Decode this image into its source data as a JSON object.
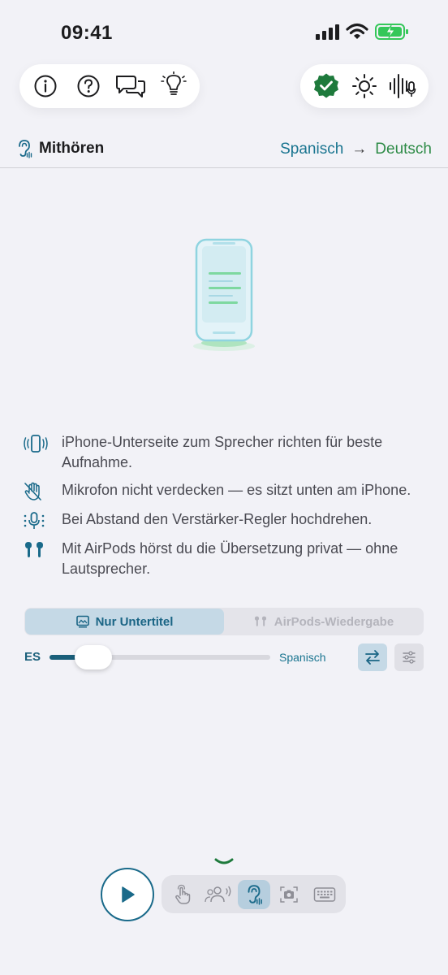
{
  "status_bar": {
    "time": "09:41"
  },
  "toolbar": {
    "left_icons": [
      "info-icon",
      "help-icon",
      "chat-bubbles-icon",
      "lightbulb-icon"
    ],
    "right_icons": [
      "verified-check-icon",
      "brightness-icon",
      "voice-waveform-icon"
    ]
  },
  "mode": {
    "label": "Mithören",
    "source_language": "Spanisch",
    "arrow": "→",
    "target_language": "Deutsch"
  },
  "tips": [
    {
      "icon": "phone-vibrate-icon",
      "text": "iPhone-Unterseite zum Sprecher richten für beste Aufnahme."
    },
    {
      "icon": "hand-slash-icon",
      "text": "Mikrofon nicht verdecken — es sitzt unten am iPhone."
    },
    {
      "icon": "mic-volume-icon",
      "text": "Bei Abstand den Verstärker-Regler hochdrehen."
    },
    {
      "icon": "airpods-icon",
      "text": "Mit AirPods hörst du die Übersetzung privat — ohne Lautsprecher."
    }
  ],
  "output_mode": {
    "options": [
      {
        "label": "Nur Untertitel",
        "icon": "subtitles-icon",
        "selected": true
      },
      {
        "label": "AirPods-Wiedergabe",
        "icon": "airpods-icon",
        "selected": false
      }
    ]
  },
  "gain": {
    "code": "ES",
    "language": "Spanisch",
    "level": 0.2
  },
  "dock": {
    "items": [
      {
        "icon": "hand-tap-icon",
        "active": false
      },
      {
        "icon": "group-speaking-icon",
        "active": false
      },
      {
        "icon": "ear-listen-icon",
        "active": true
      },
      {
        "icon": "camera-scan-icon",
        "active": false
      },
      {
        "icon": "keyboard-icon",
        "active": false
      }
    ]
  },
  "colors": {
    "accent": "#1a6a8a",
    "source_language": "#1a7590",
    "target_language": "#2e8b47",
    "verified_green": "#1e7a3c",
    "battery_green": "#34c759"
  }
}
